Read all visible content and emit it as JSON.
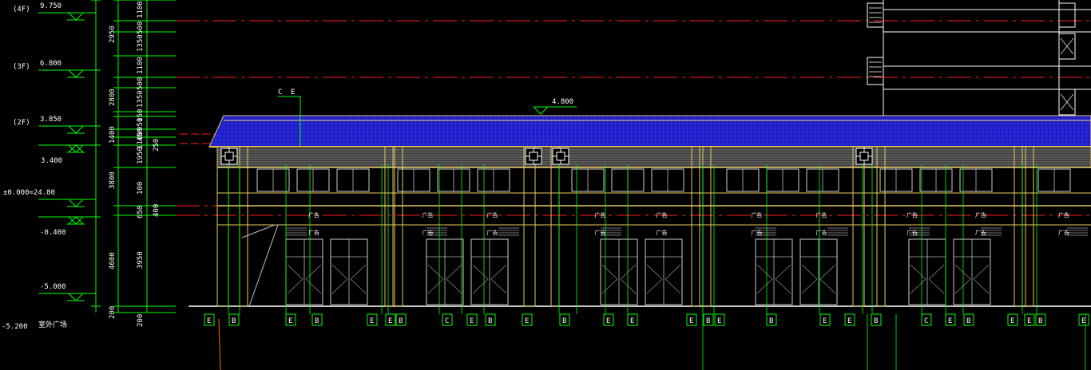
{
  "levels": [
    {
      "floor": "(4F)",
      "elev": "9.750"
    },
    {
      "floor": "(3F)",
      "elev": "6.800"
    },
    {
      "floor": "(2F)",
      "elev": "3.850"
    },
    {
      "floor": "",
      "elev": "3.400"
    },
    {
      "floor": "",
      "elev": "±0.000=24.80"
    },
    {
      "floor": "",
      "elev": "-0.400"
    },
    {
      "floor": "",
      "elev": "-5.000"
    },
    {
      "floor": "",
      "elev": "-5.200"
    }
  ],
  "outdoor_label": "室外广场",
  "dims_outer": [
    "2950",
    "2800",
    "1400",
    "3800",
    "4600",
    "200"
  ],
  "dims_inner": [
    "1100",
    "500",
    "1350",
    "1100",
    "500",
    "1350",
    "150",
    "950",
    "450",
    "1100",
    "1950",
    "100",
    "650",
    "3950",
    "200"
  ],
  "dims_right": [
    "250",
    "400"
  ],
  "roof_elev": "4.800",
  "section_mark": [
    "C",
    "E"
  ],
  "shop_sign": "广告",
  "axis_labels": [
    "E",
    "B",
    "E",
    "B",
    "E",
    "E",
    "B",
    "C",
    "E",
    "B",
    "E",
    "B",
    "E",
    "E",
    "E",
    "B",
    "E",
    "B",
    "E",
    "E",
    "B",
    "C",
    "E",
    "B",
    "E",
    "E",
    "B",
    "E"
  ],
  "colors": {
    "green": "#00ff00",
    "red": "#ff2020",
    "blue": "#1e1ec8",
    "yellow": "#e8c860",
    "white": "#ffffff",
    "grey": "#a0a0a0"
  }
}
